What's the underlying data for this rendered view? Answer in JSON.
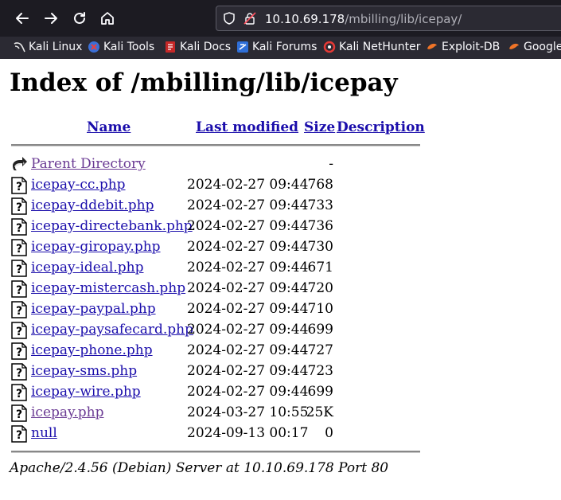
{
  "browser": {
    "url_host": "10.10.69.178",
    "url_path": "/mbilling/lib/icepay/",
    "bookmarks": [
      {
        "label": "Kali Linux",
        "icon": "kali-dragon-icon"
      },
      {
        "label": "Kali Tools",
        "icon": "kali-tools-icon"
      },
      {
        "label": "Kali Docs",
        "icon": "kali-docs-icon"
      },
      {
        "label": "Kali Forums",
        "icon": "kali-forums-icon"
      },
      {
        "label": "Kali NetHunter",
        "icon": "nethunter-icon"
      },
      {
        "label": "Exploit-DB",
        "icon": "exploit-db-icon"
      },
      {
        "label": "Google",
        "icon": "google-hacking-icon"
      }
    ]
  },
  "page": {
    "title": "Index of /mbilling/lib/icepay",
    "columns": {
      "name": "Name",
      "last_modified": "Last modified",
      "size": "Size",
      "description": "Description"
    },
    "parent": {
      "name": "Parent Directory",
      "size": "-"
    },
    "entries": [
      {
        "name": "icepay-cc.php",
        "modified": "2024-02-27 09:44",
        "size": "768",
        "visited": false
      },
      {
        "name": "icepay-ddebit.php",
        "modified": "2024-02-27 09:44",
        "size": "733",
        "visited": false
      },
      {
        "name": "icepay-directebank.php",
        "modified": "2024-02-27 09:44",
        "size": "736",
        "visited": false
      },
      {
        "name": "icepay-giropay.php",
        "modified": "2024-02-27 09:44",
        "size": "730",
        "visited": false
      },
      {
        "name": "icepay-ideal.php",
        "modified": "2024-02-27 09:44",
        "size": "671",
        "visited": false
      },
      {
        "name": "icepay-mistercash.php",
        "modified": "2024-02-27 09:44",
        "size": "720",
        "visited": false
      },
      {
        "name": "icepay-paypal.php",
        "modified": "2024-02-27 09:44",
        "size": "710",
        "visited": false
      },
      {
        "name": "icepay-paysafecard.php",
        "modified": "2024-02-27 09:44",
        "size": "699",
        "visited": false
      },
      {
        "name": "icepay-phone.php",
        "modified": "2024-02-27 09:44",
        "size": "727",
        "visited": false
      },
      {
        "name": "icepay-sms.php",
        "modified": "2024-02-27 09:44",
        "size": "723",
        "visited": false
      },
      {
        "name": "icepay-wire.php",
        "modified": "2024-02-27 09:44",
        "size": "699",
        "visited": false
      },
      {
        "name": "icepay.php",
        "modified": "2024-03-27 10:55",
        "size": "25K",
        "visited": true
      },
      {
        "name": "null",
        "modified": "2024-09-13 00:17",
        "size": "0",
        "visited": false
      }
    ],
    "footer": "Apache/2.4.56 (Debian) Server at 10.10.69.178 Port 80"
  },
  "colors": {
    "toolbar_bg": "#1c1b22",
    "bookmarks_bg": "#2b2a33",
    "link": "#1a0dab",
    "visited": "#6b3b94"
  }
}
